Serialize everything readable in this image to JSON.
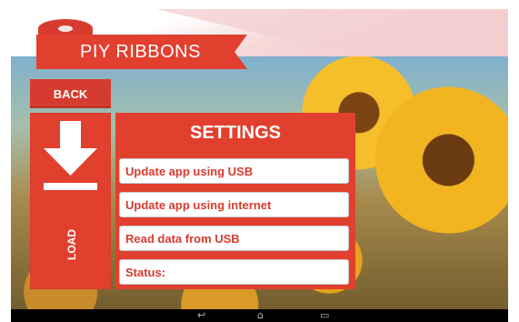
{
  "app": {
    "title": "PIY RIBBONS"
  },
  "nav": {
    "back_label": "BACK",
    "load_label": "LOAD",
    "load_icon": "download-icon"
  },
  "settings": {
    "title": "SETTINGS",
    "options": [
      {
        "label": "Update app using USB"
      },
      {
        "label": "Update app using internet"
      },
      {
        "label": "Read data from USB"
      },
      {
        "label": "Status:"
      }
    ]
  },
  "system_nav": {
    "back_icon": "↩",
    "home_icon": "⌂",
    "recents_icon": "▭"
  },
  "colors": {
    "accent": "#e2402f",
    "accent_dark": "#d63b2f",
    "option_text": "#d63b2f"
  }
}
